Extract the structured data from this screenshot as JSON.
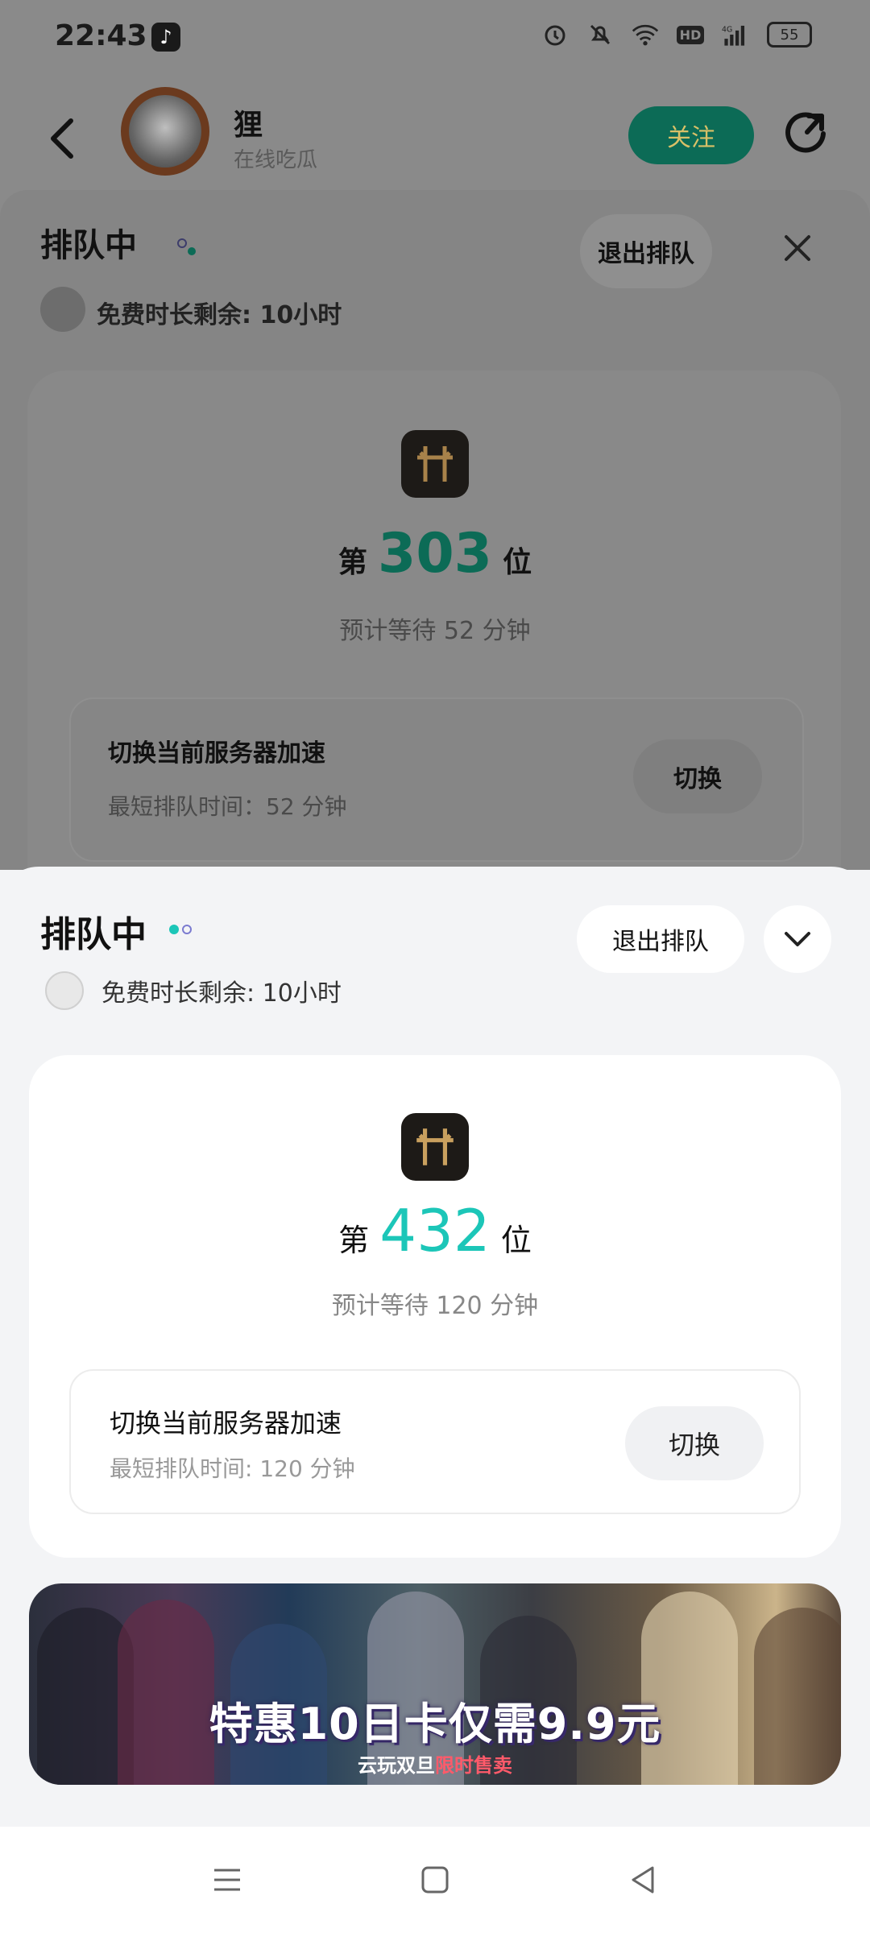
{
  "status_bar": {
    "time": "22:43",
    "icons": [
      "tiktok-icon",
      "alarm-icon",
      "mute-icon",
      "wifi-icon",
      "hd-icon",
      "signal-icon",
      "battery-icon"
    ],
    "network": "4G",
    "hd": "HD",
    "battery": "55"
  },
  "header": {
    "user_name": "狸",
    "user_status": "在线吃瓜",
    "follow_label": "关注"
  },
  "background_sheet": {
    "queue_title": "排队中",
    "free_time": "免费时长剩余: 10小时",
    "exit_label": "退出排队",
    "rank_prefix": "第",
    "rank": "303",
    "rank_suffix": "位",
    "wait": "预计等待 52 分钟",
    "switch_title": "切换当前服务器加速",
    "switch_sub": "最短排队时间：52 分钟",
    "switch_label": "切换"
  },
  "queue_sheet": {
    "queue_title": "排队中",
    "free_time": "免费时长剩余: 10小时",
    "exit_label": "退出排队",
    "rank_prefix": "第",
    "rank": "432",
    "rank_suffix": "位",
    "wait": "预计等待 120 分钟",
    "switch_title": "切换当前服务器加速",
    "switch_sub": "最短排队时间: 120 分钟",
    "switch_label": "切换"
  },
  "banner": {
    "title": "特惠10日卡仅需9.9元",
    "sub_prefix": "云玩双旦",
    "sub_highlight": "限时售卖"
  },
  "colors": {
    "accent": "#1cc6b8",
    "follow_bg": "#0c6b56",
    "follow_text": "#d9c067"
  }
}
